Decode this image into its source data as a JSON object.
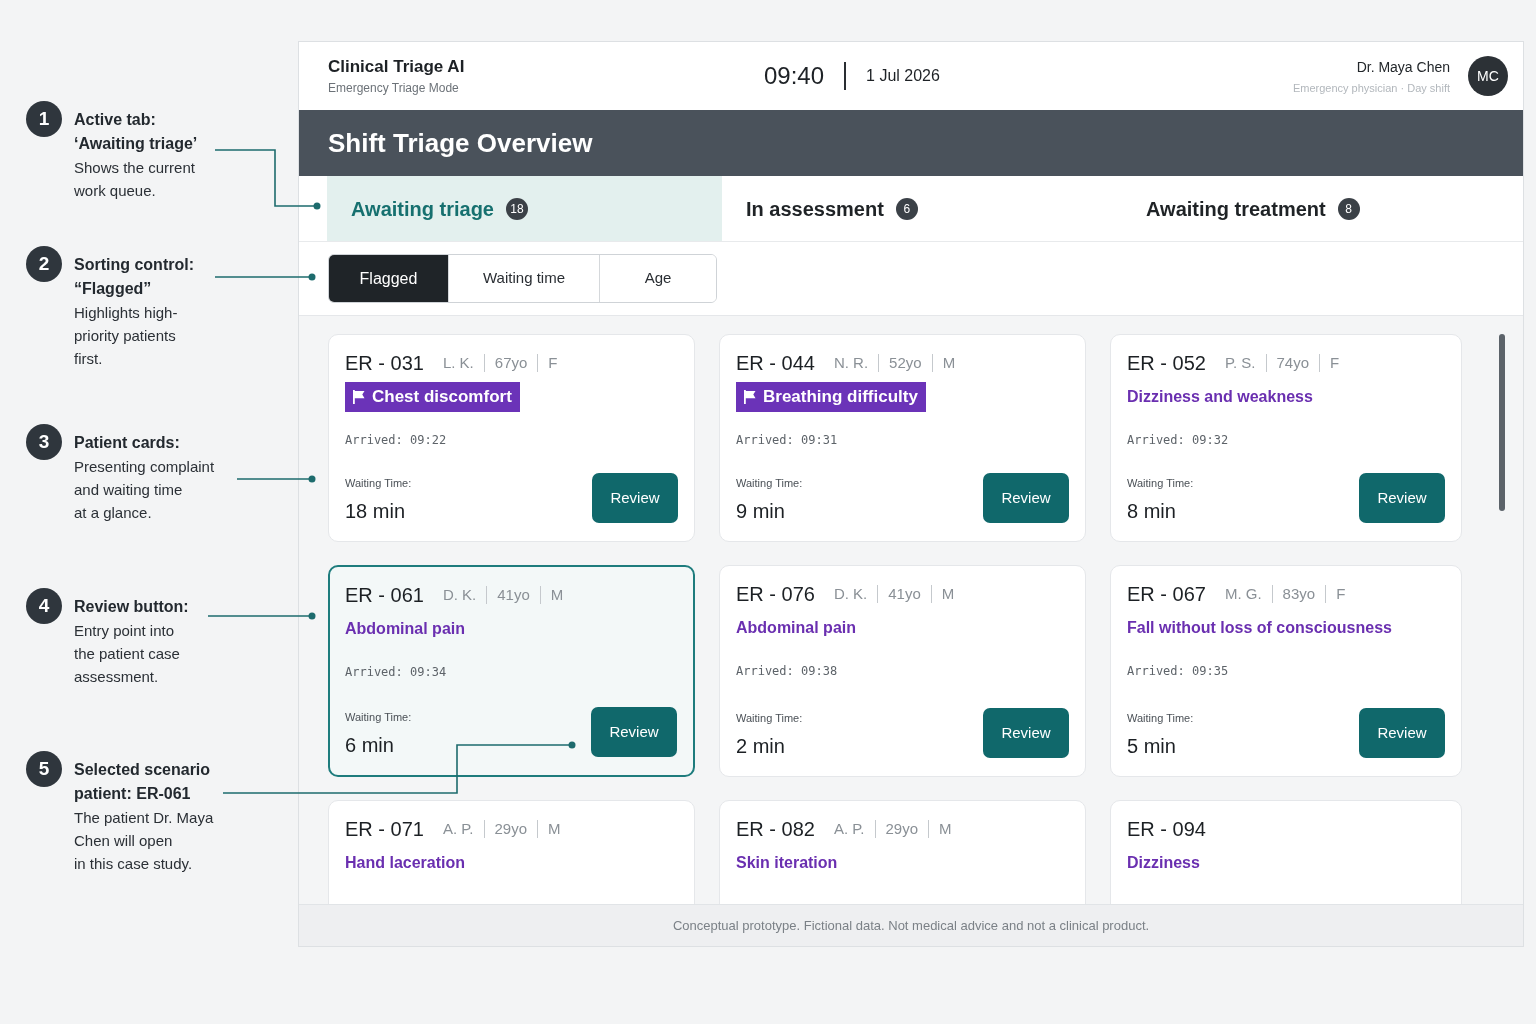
{
  "annotations": [
    {
      "number": "1",
      "title": "Active tab:\n‘Awaiting triage’",
      "text": "Shows the current\nwork queue."
    },
    {
      "number": "2",
      "title": "Sorting control:\n“Flagged”",
      "text": "Highlights high-\npriority patients\nfirst."
    },
    {
      "number": "3",
      "title": "Patient cards:",
      "text": "Presenting complaint\nand waiting time\nat a glance."
    },
    {
      "number": "4",
      "title": "Review button:",
      "text": "Entry point into\nthe patient case\nassessment."
    },
    {
      "number": "5",
      "title": "Selected scenario\npatient: ER-061",
      "text": "The patient Dr. Maya\nChen will open\nin this case study."
    }
  ],
  "header": {
    "app_title": "Clinical Triage AI",
    "mode": "Emergency Triage Mode",
    "time": "09:40",
    "date": "1 Jul 2026",
    "user": {
      "name": "Dr. Maya Chen",
      "role": "Emergency physician · Day shift",
      "initials": "MC"
    }
  },
  "page_title": "Shift Triage Overview",
  "tabs": [
    {
      "label": "Awaiting triage",
      "count": "18",
      "selected": true
    },
    {
      "label": "In assessment",
      "count": "6",
      "selected": false
    },
    {
      "label": "Awaiting treatment",
      "count": "8",
      "selected": false
    }
  ],
  "sort_options": [
    {
      "label": "Flagged",
      "selected": true
    },
    {
      "label": "Waiting time",
      "selected": false
    },
    {
      "label": "Age",
      "selected": false
    }
  ],
  "cards": [
    {
      "id": "ER - 031",
      "details": [
        "L. K.",
        "67yo",
        "F"
      ],
      "complaint": "Chest discomfort",
      "flagged": true,
      "arrived": "Arrived: 09:22",
      "waiting_label": "Waiting Time:",
      "waiting": "18 min",
      "button": "Review",
      "selected": false
    },
    {
      "id": "ER - 044",
      "details": [
        "N. R.",
        "52yo",
        "M"
      ],
      "complaint": "Breathing difficulty",
      "flagged": true,
      "arrived": "Arrived: 09:31",
      "waiting_label": "Waiting Time:",
      "waiting": "9 min",
      "button": "Review",
      "selected": false
    },
    {
      "id": "ER - 052",
      "details": [
        "P. S.",
        "74yo",
        "F"
      ],
      "complaint": "Dizziness and weakness",
      "flagged": false,
      "arrived": "Arrived: 09:32",
      "waiting_label": "Waiting Time:",
      "waiting": "8 min",
      "button": "Review",
      "selected": false
    },
    {
      "id": "ER - 061",
      "details": [
        "D. K.",
        "41yo",
        "M"
      ],
      "complaint": "Abdominal pain",
      "flagged": false,
      "arrived": "Arrived: 09:34",
      "waiting_label": "Waiting Time:",
      "waiting": "6 min",
      "button": "Review",
      "selected": true
    },
    {
      "id": "ER - 076",
      "details": [
        "D. K.",
        "41yo",
        "M"
      ],
      "complaint": "Abdominal pain",
      "flagged": false,
      "arrived": "Arrived: 09:38",
      "waiting_label": "Waiting Time:",
      "waiting": "2 min",
      "button": "Review",
      "selected": false
    },
    {
      "id": "ER - 067",
      "details": [
        "M. G.",
        "83yo",
        "F"
      ],
      "complaint": "Fall without loss of consciousness",
      "flagged": false,
      "arrived": "Arrived: 09:35",
      "waiting_label": "Waiting Time:",
      "waiting": "5 min",
      "button": "Review",
      "selected": false
    },
    {
      "id": "ER - 071",
      "details": [
        "A. P.",
        "29yo",
        "M"
      ],
      "complaint": "Hand laceration",
      "flagged": false,
      "selected": false
    },
    {
      "id": "ER - 082",
      "details": [
        "A. P.",
        "29yo",
        "M"
      ],
      "complaint": "Skin iteration",
      "flagged": false,
      "selected": false
    },
    {
      "id": "ER - 094",
      "complaint": "Dizziness",
      "flagged": false,
      "selected": false
    }
  ],
  "footer": "Conceptual prototype. Fictional data. Not medical advice and not a clinical product."
}
